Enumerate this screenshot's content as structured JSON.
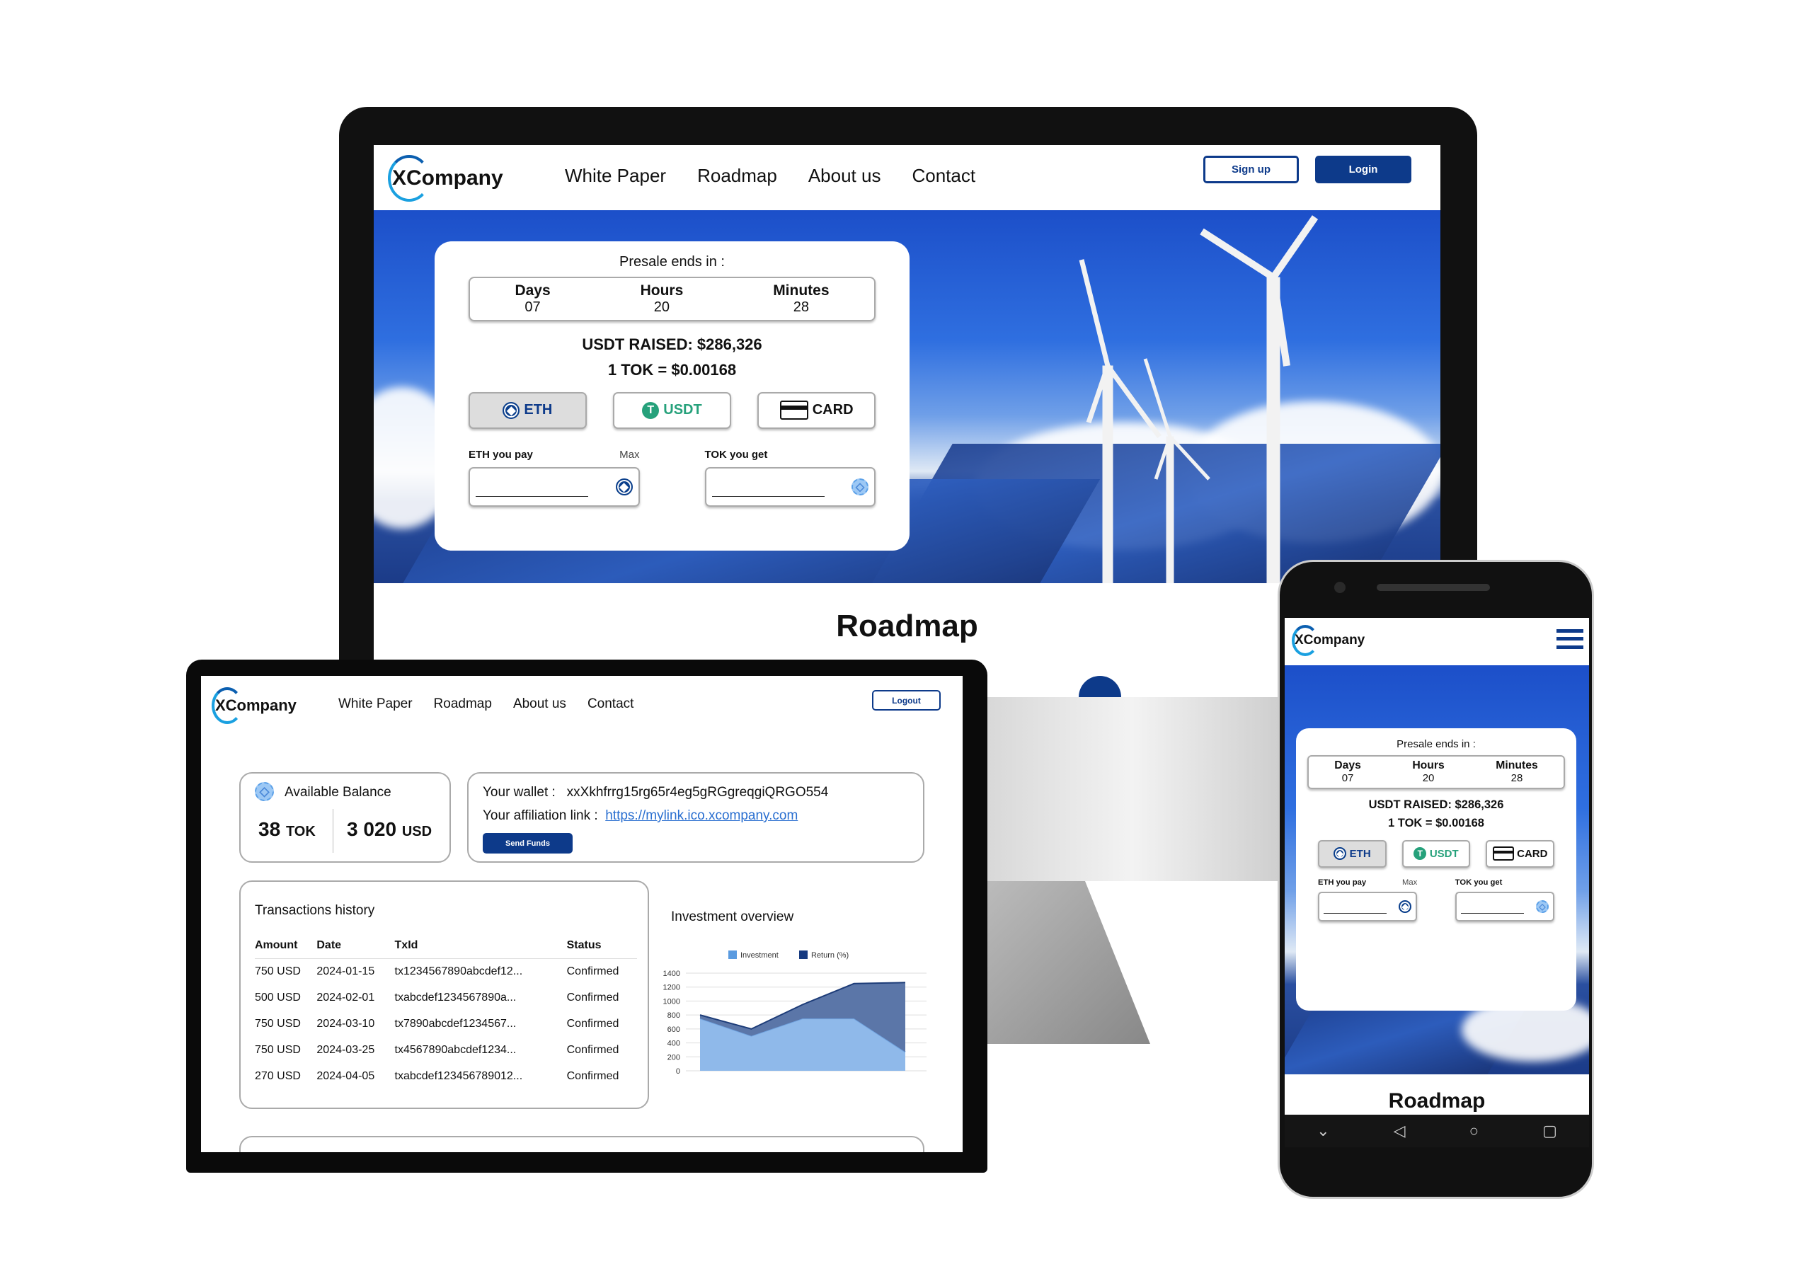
{
  "brand": "XCompany",
  "nav": {
    "links": [
      "White Paper",
      "Roadmap",
      "About us",
      "Contact"
    ],
    "signup": "Sign up",
    "login": "Login",
    "logout": "Logout"
  },
  "presale": {
    "title": "Presale ends in :",
    "countdown": [
      {
        "label": "Days",
        "value": "07"
      },
      {
        "label": "Hours",
        "value": "20"
      },
      {
        "label": "Minutes",
        "value": "28"
      }
    ],
    "raised": "USDT RAISED: $286,326",
    "rate": "1 TOK = $0.00168",
    "methods": [
      {
        "label": "ETH",
        "icon": "ethereum-icon",
        "selected": true
      },
      {
        "label": "USDT",
        "icon": "tether-icon",
        "selected": false
      },
      {
        "label": "CARD",
        "icon": "credit-card-icon",
        "selected": false
      }
    ],
    "pay_label": "ETH you pay",
    "max_label": "Max",
    "get_label": "TOK you get",
    "pay_value": "",
    "get_value": ""
  },
  "roadmap_title": "Roadmap",
  "dashboard": {
    "balance_title": "Available Balance",
    "tok_amount": "38",
    "tok_unit": "TOK",
    "usd_amount": "3 020",
    "usd_unit": "USD",
    "wallet_label": "Your wallet :",
    "wallet_value": "xxXkhfrrg15rg65r4eg5gRGgreqgiQRGO554",
    "affiliation_label": "Your affiliation link :",
    "affiliation_link": "https://mylink.ico.xcompany.com",
    "send_funds": "Send Funds",
    "transactions_title": "Transactions history",
    "columns": [
      "Amount",
      "Date",
      "TxId",
      "Status"
    ],
    "rows": [
      [
        "750 USD",
        "2024-01-15",
        "tx1234567890abcdef12...",
        "Confirmed"
      ],
      [
        "500 USD",
        "2024-02-01",
        "txabcdef1234567890a...",
        "Confirmed"
      ],
      [
        "750 USD",
        "2024-03-10",
        "tx7890abcdef1234567...",
        "Confirmed"
      ],
      [
        "750 USD",
        "2024-03-25",
        "tx4567890abcdef1234...",
        "Confirmed"
      ],
      [
        "270 USD",
        "2024-04-05",
        "txabcdef123456789012...",
        "Confirmed"
      ]
    ],
    "chart_title": "Investment overview"
  },
  "chart_data": {
    "type": "area",
    "stacked": true,
    "title": "Investment overview",
    "yticks": [
      "0",
      "200",
      "400",
      "600",
      "800",
      "1000",
      "1200",
      "1400"
    ],
    "ylim": [
      0,
      1400
    ],
    "grid": true,
    "legend": "top",
    "series": [
      {
        "name": "Investment",
        "color": "#8fb9ea",
        "values": [
          750,
          500,
          750,
          750,
          270
        ]
      },
      {
        "name": "Return (%)",
        "color": "#5b76a8",
        "values": [
          50,
          100,
          200,
          500,
          995
        ]
      }
    ]
  },
  "colors": {
    "primary": "#0d3a8a",
    "link": "#2a6fd0",
    "usdt": "#26a17b"
  }
}
